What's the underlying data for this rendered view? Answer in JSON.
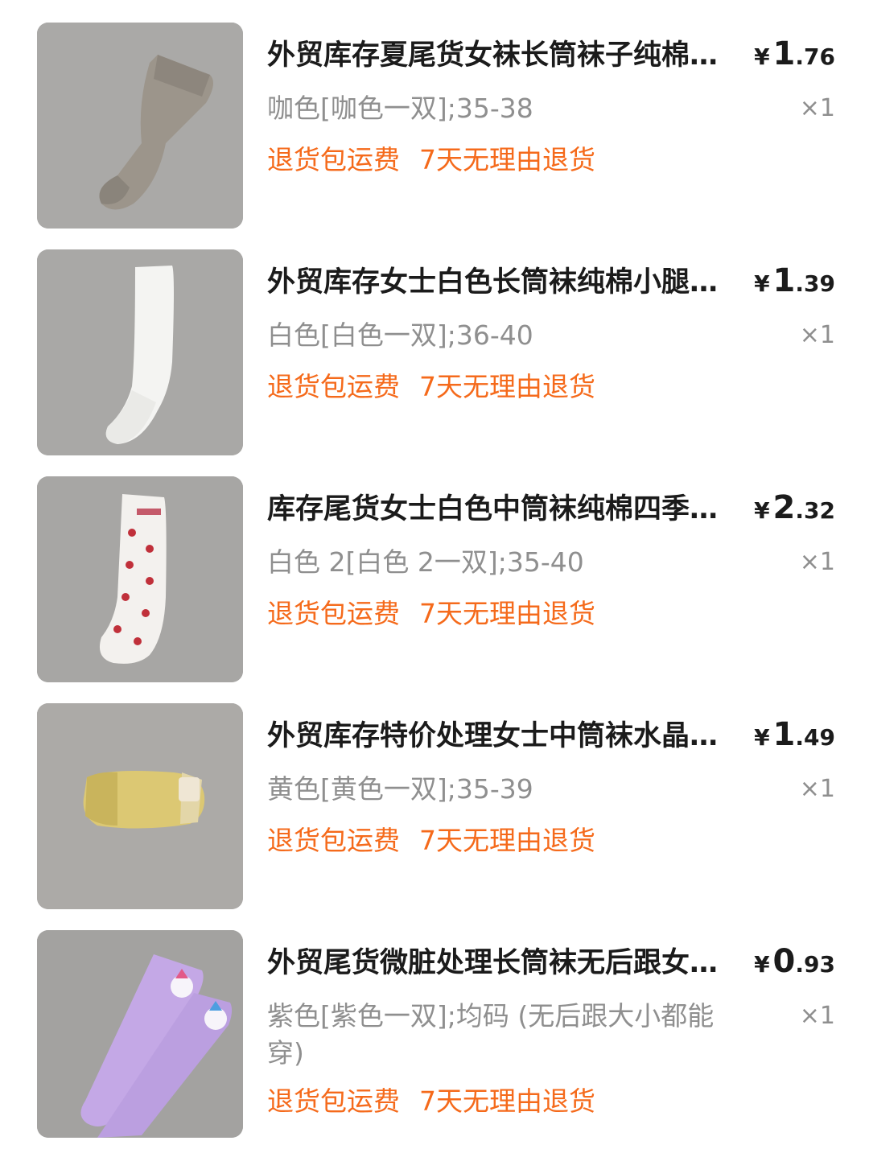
{
  "orders": [
    {
      "title": "外贸库存夏尾货女袜长筒袜子纯棉…",
      "currency": "¥",
      "price_int": "1",
      "price_dec": ".76",
      "spec": "咖色[咖色一双];35-38",
      "qty": "×1",
      "tags": [
        "退货包运费",
        "7天无理由退货"
      ],
      "image": "gray-knit-long-sock",
      "image_color": "#9c958b"
    },
    {
      "title": "外贸库存女士白色长筒袜纯棉小腿…",
      "currency": "¥",
      "price_int": "1",
      "price_dec": ".39",
      "spec": "白色[白色一双];36-40",
      "qty": "×1",
      "tags": [
        "退货包运费",
        "7天无理由退货"
      ],
      "image": "white-knee-sock",
      "image_color": "#f4f4f2"
    },
    {
      "title": "库存尾货女士白色中筒袜纯棉四季…",
      "currency": "¥",
      "price_int": "2",
      "price_dec": ".32",
      "spec": "白色 2[白色 2一双];35-40",
      "qty": "×1",
      "tags": [
        "退货包运费",
        "7天无理由退货"
      ],
      "image": "white-cherry-sock",
      "image_color": "#f3f1ee"
    },
    {
      "title": "外贸库存特价处理女士中筒袜水晶…",
      "currency": "¥",
      "price_int": "1",
      "price_dec": ".49",
      "spec": "黄色[黄色一双];35-39",
      "qty": "×1",
      "tags": [
        "退货包运费",
        "7天无理由退货"
      ],
      "image": "yellow-lace-sock",
      "image_color": "#dcc873"
    },
    {
      "title": "外贸尾货微脏处理长筒袜无后跟女…",
      "currency": "¥",
      "price_int": "0",
      "price_dec": ".93",
      "spec": "紫色[紫色一双];均码 (无后跟大小都能穿)",
      "qty": "×1",
      "tags": [
        "退货包运费",
        "7天无理由退货"
      ],
      "image": "purple-unicorn-socks",
      "image_color": "#c4a8e6"
    }
  ],
  "colors": {
    "tag": "#f56a1b",
    "muted": "#8f8f8f",
    "title": "#1b1b1b",
    "photo_bg": "#a9a8a6"
  }
}
